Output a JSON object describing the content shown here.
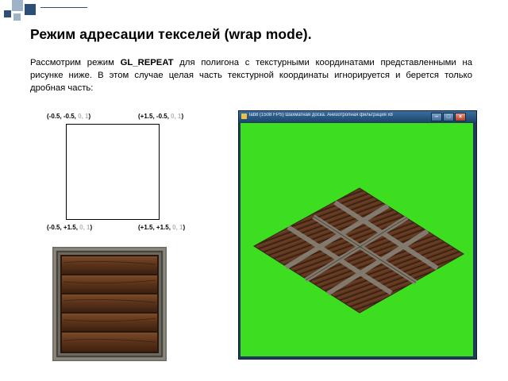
{
  "slide": {
    "title": "Режим адресации текселей (wrap mode).",
    "paragraph": {
      "before": "Рассмотрим режим ",
      "keyword": "GL_REPEAT",
      "after": " для полигона с текстурными координатами представленными на рисунке ниже. В этом случае целая часть текстурной координаты игнорируется и берется только дробная часть:"
    }
  },
  "quad": {
    "corners": [
      {
        "id": "top-left",
        "pos": "(-0.5, -0.5, ",
        "uv": "0, 1",
        "close": ")"
      },
      {
        "id": "top-right",
        "pos": "(+1.5, -0.5, ",
        "uv": "0, 1",
        "close": ")"
      },
      {
        "id": "bottom-left",
        "pos": "(-0.5, +1.5, ",
        "uv": "0, 1",
        "close": ")"
      },
      {
        "id": "bottom-right",
        "pos": "(+1.5, +1.5, ",
        "uv": "0, 1",
        "close": ")"
      }
    ]
  },
  "window": {
    "title": "lab8 (1508 FPS) Шахматная доска. Анизотропная фильтрация x8",
    "buttons": {
      "minimize": "–",
      "maximize": "□",
      "close": "×"
    },
    "background_color": "#3ddd1f"
  },
  "colors": {
    "accent": "#3a6ea0",
    "deco_square": "#2c4f78",
    "deco_light": "#9fb3c8",
    "uv_gray": "#b4b4b4",
    "wood_dark": "#3a2114",
    "wood_mid": "#6a3d22",
    "frame_gray": "#6c6a60"
  },
  "icons": [
    "corner-squares-decoration",
    "app-window-icon"
  ]
}
